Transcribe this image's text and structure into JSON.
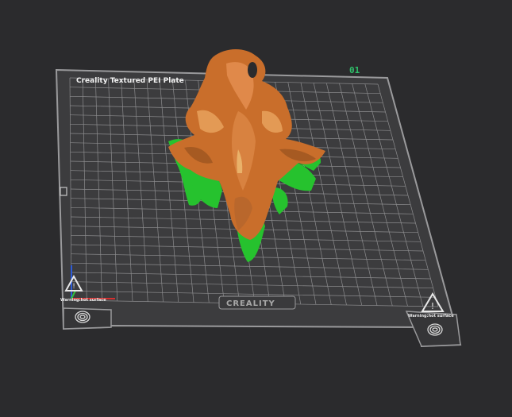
{
  "plate": {
    "label": "Creality Textured PEI Plate",
    "number": "01",
    "brand": "CREALITY",
    "warning_left": "Warning:hot surface",
    "warning_right": "Warning:hot surface"
  },
  "colors": {
    "background": "#2b2b2d",
    "plate": "#3c3c3e",
    "grid": "#8c8c8e",
    "model": "#d07a35",
    "support": "#26c22e",
    "plate_number": "#2fc06a"
  },
  "icons": [
    "axis-gizmo-icon",
    "warning-triangle-icon",
    "fingerprint-icon"
  ]
}
